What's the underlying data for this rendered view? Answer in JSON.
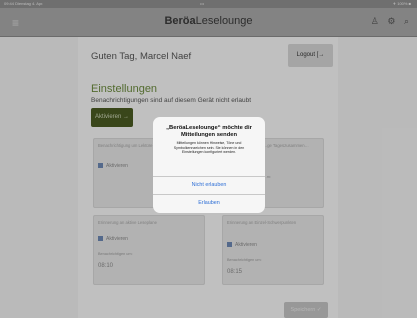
{
  "status": {
    "time_date": "09:44  Dienstag 4. Apr.",
    "center": "•••",
    "right": "✈ 100% ■"
  },
  "nav": {
    "menu_glyph": "≡",
    "title_bold": "Beröa",
    "title_rest": "Leselounge",
    "icons": [
      "person-icon",
      "settings-user-icon",
      "search-icon"
    ]
  },
  "main": {
    "greeting": "Guten Tag, Marcel Naef",
    "logout_label": "Logout [→",
    "section_title": "Einstellungen",
    "section_subtitle": "Benachrichtigungen sind auf diesem Gerät nicht erlaubt",
    "activate_label": "Aktivieren  →"
  },
  "cards": [
    {
      "title": "Benachrichtigung um Lektüre Berichte",
      "check_label": "Aktivieren",
      "time_label": "",
      "time": ""
    },
    {
      "title": "…ge Tageszusammen…",
      "check_label": "",
      "time_label": "…m:",
      "time": ""
    },
    {
      "title": "Erinnerung an aktive Leseplane",
      "check_label": "Aktivieren",
      "time_label": "Benachrichtigen um:",
      "time": "08:10"
    },
    {
      "title": "Erinnerung an Einzel-Schwerpunkten",
      "check_label": "Aktivieren",
      "time_label": "Benachrichtigen um:",
      "time": "08:15"
    }
  ],
  "save_label": "Speichern  ✓",
  "dialog": {
    "title": "„BeröaLeselounge“ möchte dir Mitteilungen senden",
    "message": "Mitteilungen können Hinweise, Töne und Symbolkennzeichen sein. Sie können in den Einstellungen konfiguriert werden.",
    "deny_label": "Nicht erlauben",
    "allow_label": "Erlauben"
  },
  "colors": {
    "accent_green": "#4a5a22",
    "ios_blue": "#2e6fd6"
  }
}
